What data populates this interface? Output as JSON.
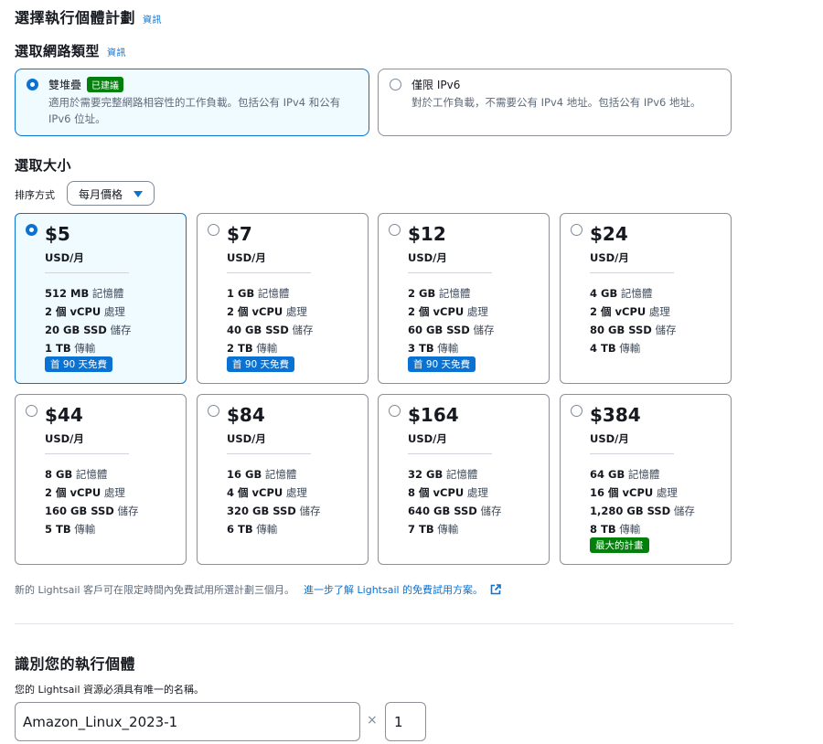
{
  "header": {
    "title": "選擇執行個體計劃",
    "info": "資訊"
  },
  "network": {
    "title": "選取網路類型",
    "info": "資訊",
    "options": [
      {
        "label": "雙堆疊",
        "badge": "已建議",
        "desc": "適用於需要完整網路相容性的工作負載。包括公有 IPv4 和公有 IPv6 位址。",
        "selected": true
      },
      {
        "label": "僅限 IPv6",
        "desc": "對於工作負載，不需要公有 IPv4 地址。包括公有 IPv6 地址。",
        "selected": false
      }
    ]
  },
  "size": {
    "title": "選取大小",
    "sort_label": "排序方式",
    "sort_value": "每月價格",
    "plans": [
      {
        "price": "$5",
        "unit": "USD/月",
        "mem": "512 MB",
        "mem_lbl": "記憶體",
        "cpu": "2 個 vCPU",
        "cpu_lbl": "處理",
        "ssd": "20 GB SSD",
        "ssd_lbl": "儲存",
        "xfer": "1 TB",
        "xfer_lbl": "傳輸",
        "badge": "首 90 天免費",
        "selected": true
      },
      {
        "price": "$7",
        "unit": "USD/月",
        "mem": "1 GB",
        "mem_lbl": "記憶體",
        "cpu": "2 個 vCPU",
        "cpu_lbl": "處理",
        "ssd": "40 GB SSD",
        "ssd_lbl": "儲存",
        "xfer": "2 TB",
        "xfer_lbl": "傳輸",
        "badge": "首 90 天免費"
      },
      {
        "price": "$12",
        "unit": "USD/月",
        "mem": "2 GB",
        "mem_lbl": "記憶體",
        "cpu": "2 個 vCPU",
        "cpu_lbl": "處理",
        "ssd": "60 GB SSD",
        "ssd_lbl": "儲存",
        "xfer": "3 TB",
        "xfer_lbl": "傳輸",
        "badge": "首 90 天免費"
      },
      {
        "price": "$24",
        "unit": "USD/月",
        "mem": "4 GB",
        "mem_lbl": "記憶體",
        "cpu": "2 個 vCPU",
        "cpu_lbl": "處理",
        "ssd": "80 GB SSD",
        "ssd_lbl": "儲存",
        "xfer": "4 TB",
        "xfer_lbl": "傳輸"
      },
      {
        "price": "$44",
        "unit": "USD/月",
        "mem": "8 GB",
        "mem_lbl": "記憶體",
        "cpu": "2 個 vCPU",
        "cpu_lbl": "處理",
        "ssd": "160 GB SSD",
        "ssd_lbl": "儲存",
        "xfer": "5 TB",
        "xfer_lbl": "傳輸"
      },
      {
        "price": "$84",
        "unit": "USD/月",
        "mem": "16 GB",
        "mem_lbl": "記憶體",
        "cpu": "4 個 vCPU",
        "cpu_lbl": "處理",
        "ssd": "320 GB SSD",
        "ssd_lbl": "儲存",
        "xfer": "6 TB",
        "xfer_lbl": "傳輸"
      },
      {
        "price": "$164",
        "unit": "USD/月",
        "mem": "32 GB",
        "mem_lbl": "記憶體",
        "cpu": "8 個 vCPU",
        "cpu_lbl": "處理",
        "ssd": "640 GB SSD",
        "ssd_lbl": "儲存",
        "xfer": "7 TB",
        "xfer_lbl": "傳輸"
      },
      {
        "price": "$384",
        "unit": "USD/月",
        "mem": "64 GB",
        "mem_lbl": "記憶體",
        "cpu": "16 個 vCPU",
        "cpu_lbl": "處理",
        "ssd": "1,280 GB SSD",
        "ssd_lbl": "儲存",
        "xfer": "8 TB",
        "xfer_lbl": "傳輸",
        "badge_alt": "最大的計畫"
      }
    ],
    "note": "新的 Lightsail 客戶可在限定時間內免費試用所選計劃三個月。",
    "note_link": "進一步了解 Lightsail 的免費試用方案。"
  },
  "identify": {
    "title": "識別您的執行個體",
    "desc": "您的 Lightsail 資源必須具有唯一的名稱。",
    "name_value": "Amazon_Linux_2023-1",
    "times": "×",
    "count_value": "1"
  },
  "colors": {
    "accent": "#0972d3",
    "success": "#037f0c",
    "selected_bg": "#f0fbff"
  }
}
